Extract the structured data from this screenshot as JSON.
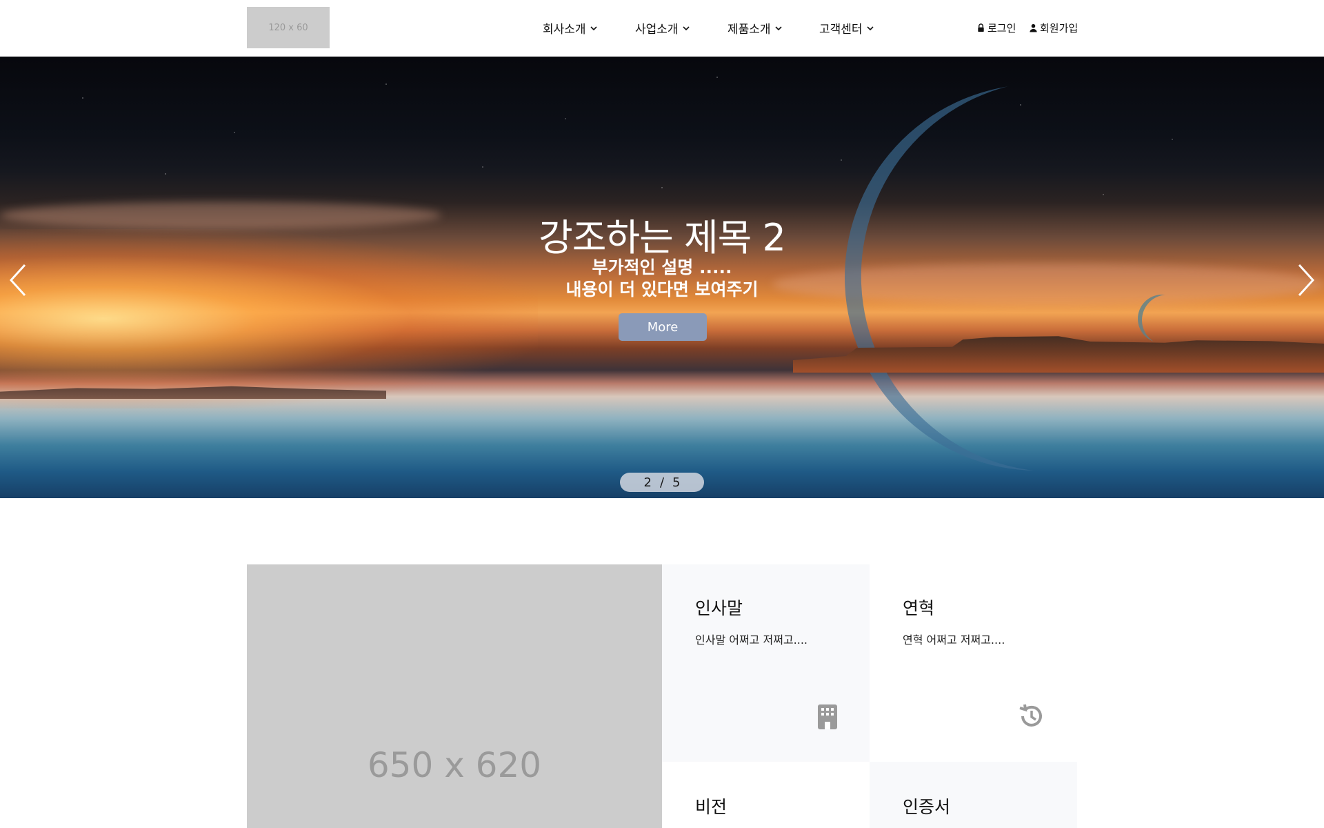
{
  "header": {
    "logo_text": "120 x 60",
    "nav": [
      {
        "label": "회사소개"
      },
      {
        "label": "사업소개"
      },
      {
        "label": "제품소개"
      },
      {
        "label": "고객센터"
      }
    ],
    "login_label": "로그인",
    "signup_label": "회원가입"
  },
  "hero": {
    "title": "강조하는 제목 2",
    "subtitle_line1": "부가적인 설명 .....",
    "subtitle_line2": "내용이 더 있다면 보여주기",
    "more_label": "More",
    "pager_current": "2",
    "pager_separator": "/",
    "pager_total": "5",
    "more_button_color": "#8a9ab8"
  },
  "content": {
    "placeholder_text": "650 x 620",
    "cards": [
      {
        "title": "인사말",
        "text": "인사말 어쩌고 저쩌고....",
        "icon": "building-icon"
      },
      {
        "title": "연혁",
        "text": "연혁 어쩌고 저쩌고....",
        "icon": "history-icon"
      },
      {
        "title": "비전"
      },
      {
        "title": "인증서"
      }
    ]
  }
}
